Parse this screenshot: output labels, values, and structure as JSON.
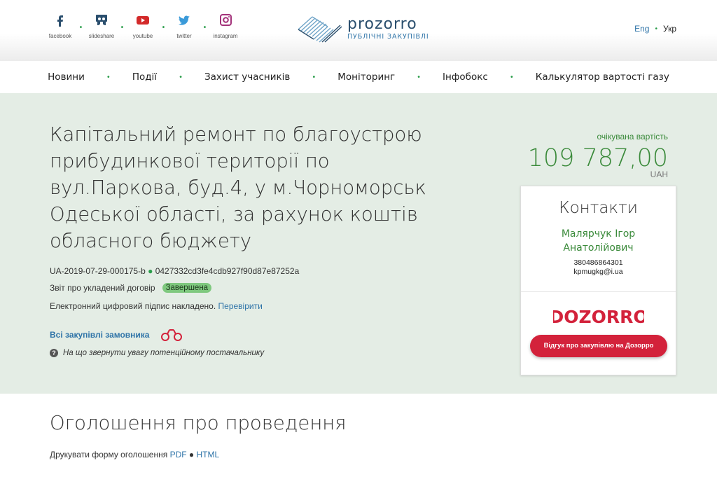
{
  "header": {
    "social": [
      {
        "label": "facebook",
        "icon": "facebook-icon"
      },
      {
        "label": "slideshare",
        "icon": "slideshare-icon"
      },
      {
        "label": "youtube",
        "icon": "youtube-icon"
      },
      {
        "label": "twitter",
        "icon": "twitter-icon"
      },
      {
        "label": "instagram",
        "icon": "instagram-icon"
      }
    ],
    "logo_name": "prozorro",
    "logo_sub": "ПУБЛІЧНІ ЗАКУПІВЛІ",
    "lang_en": "Eng",
    "lang_uk": "Укр"
  },
  "nav": {
    "items": [
      "Новини",
      "Події",
      "Захист учасників",
      "Моніторинг",
      "Інфобокс",
      "Калькулятор вартості газу"
    ]
  },
  "tender": {
    "title": "Капітальний ремонт по благоустрою прибудинкової території по вул.Паркова, буд.4, у м.Чорноморськ Одеської області, за рахунок коштів обласного бюджету",
    "id": "UA-2019-07-29-000175-b",
    "hash": "0427332cd3fe4cdb927f90d87e87252a",
    "report_label": "Звіт про укладений договір",
    "status": "Завершена",
    "signature_text": "Електронний цифровий підпис накладено.",
    "signature_link": "Перевірити",
    "all_procurements": "Всі закупівлі замовника",
    "hint": "На що звернути увагу потенційному постачальнику",
    "price_label": "очікувана вартість",
    "price": "109 787,00",
    "currency": "UAH"
  },
  "contacts": {
    "title": "Контакти",
    "name": "Малярчук Ігор Анатолійович",
    "phone": "380486864301",
    "email": "kpmugkg@i.ua",
    "dozorro_logo": "DOZORRO",
    "dozorro_button": "Відгук про закупівлю на Дозорро"
  },
  "announcement": {
    "title": "Оголошення про проведення",
    "print_label": "Друкувати форму оголошення",
    "pdf": "PDF",
    "html": "HTML"
  },
  "colors": {
    "accent_green": "#3a8a3a",
    "link_blue": "#2f74a8",
    "hero_bg": "#e4ede5",
    "dozorro_red": "#d3223b"
  }
}
